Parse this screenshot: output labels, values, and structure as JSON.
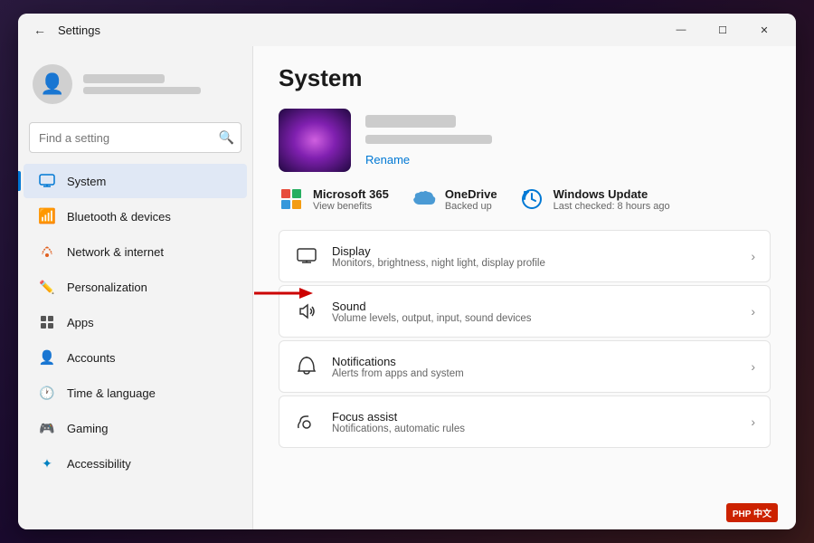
{
  "window": {
    "title": "Settings",
    "controls": {
      "minimize": "—",
      "maximize": "☐",
      "close": "✕"
    }
  },
  "sidebar": {
    "search_placeholder": "Find a setting",
    "user": {
      "name_blur": "",
      "email_blur": ""
    },
    "nav_items": [
      {
        "id": "system",
        "label": "System",
        "icon": "🖥",
        "active": true
      },
      {
        "id": "bluetooth",
        "label": "Bluetooth & devices",
        "icon": "🔵",
        "active": false
      },
      {
        "id": "network",
        "label": "Network & internet",
        "icon": "📶",
        "active": false
      },
      {
        "id": "personalization",
        "label": "Personalization",
        "icon": "✏️",
        "active": false
      },
      {
        "id": "apps",
        "label": "Apps",
        "icon": "📦",
        "active": false
      },
      {
        "id": "accounts",
        "label": "Accounts",
        "icon": "👤",
        "active": false
      },
      {
        "id": "time",
        "label": "Time & language",
        "icon": "🕐",
        "active": false
      },
      {
        "id": "gaming",
        "label": "Gaming",
        "icon": "🎮",
        "active": false
      },
      {
        "id": "accessibility",
        "label": "Accessibility",
        "icon": "♿",
        "active": false
      }
    ]
  },
  "main": {
    "title": "System",
    "profile": {
      "rename_label": "Rename"
    },
    "services": [
      {
        "id": "ms365",
        "name": "Microsoft 365",
        "sub": "View benefits"
      },
      {
        "id": "onedrive",
        "name": "OneDrive",
        "sub": "Backed up"
      },
      {
        "id": "winupdate",
        "name": "Windows Update",
        "sub": "Last checked: 8 hours ago"
      }
    ],
    "settings": [
      {
        "id": "display",
        "icon": "🖥",
        "title": "Display",
        "desc": "Monitors, brightness, night light, display profile"
      },
      {
        "id": "sound",
        "icon": "🔊",
        "title": "Sound",
        "desc": "Volume levels, output, input, sound devices"
      },
      {
        "id": "notifications",
        "icon": "🔔",
        "title": "Notifications",
        "desc": "Alerts from apps and system"
      },
      {
        "id": "focus",
        "icon": "🌙",
        "title": "Focus assist",
        "desc": "Notifications, automatic rules"
      }
    ]
  },
  "php_badge": "PHP 中文"
}
